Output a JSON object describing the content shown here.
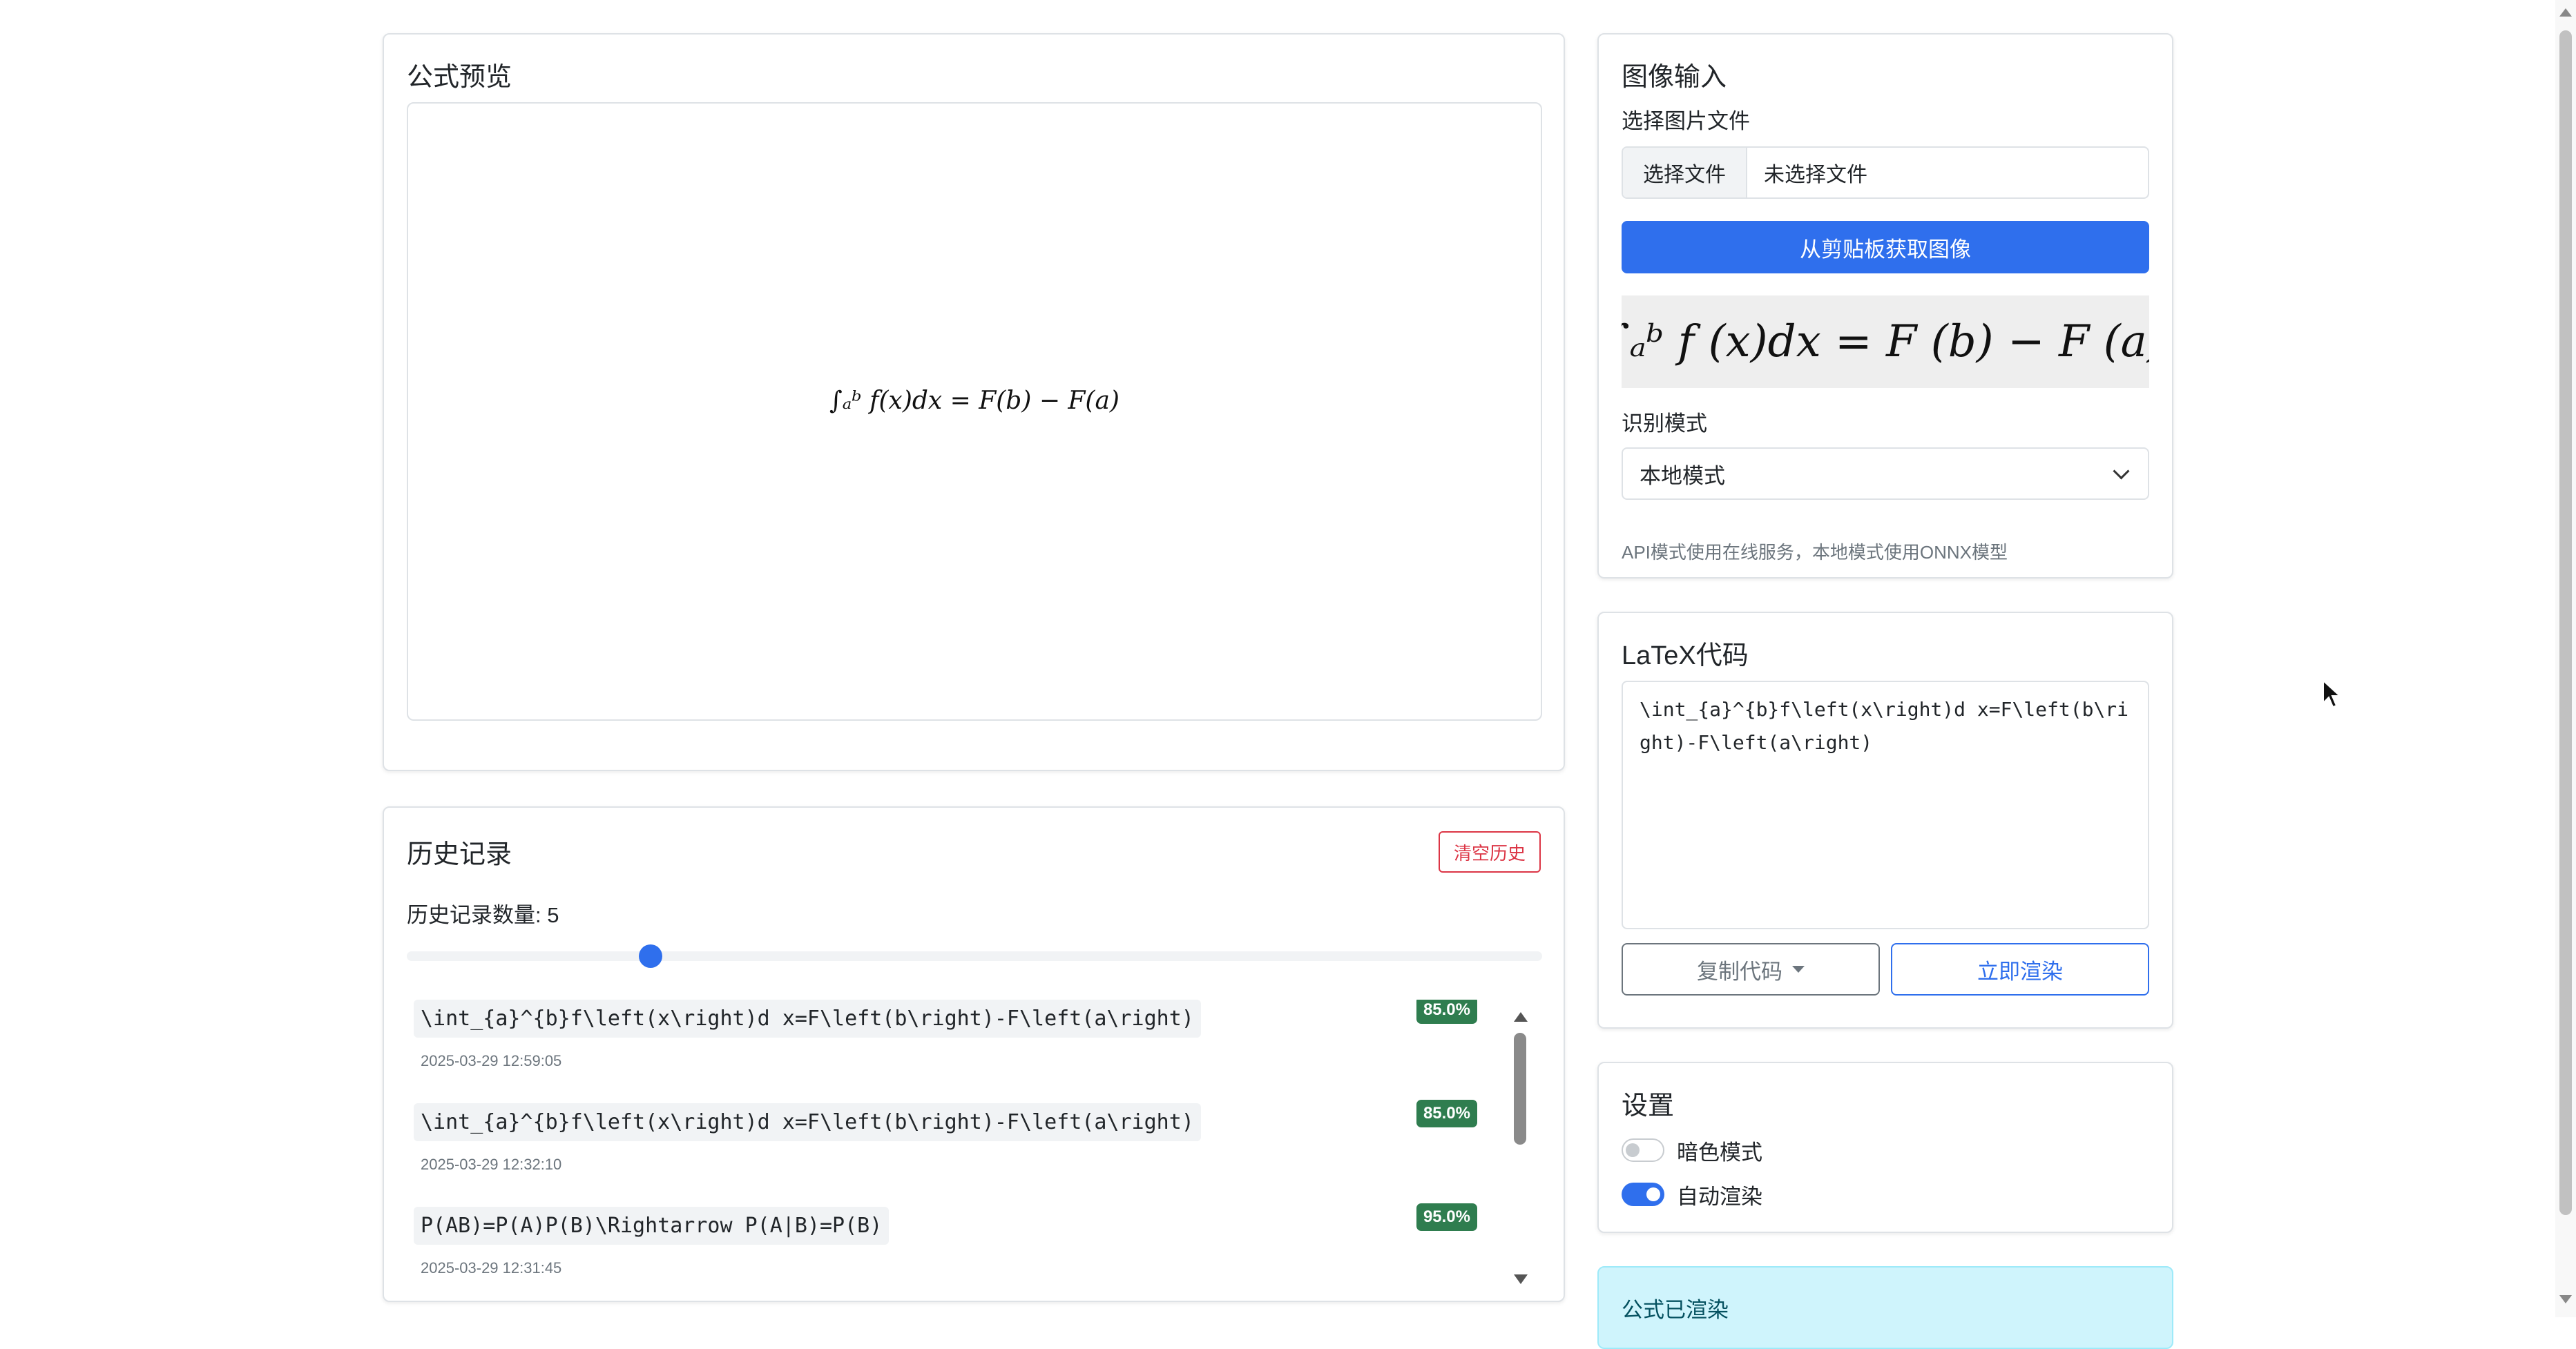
{
  "preview": {
    "title": "公式预览",
    "formula": "∫ₐᵇ f(x)dx = F(b) − F(a)"
  },
  "history": {
    "title": "历史记录",
    "clear_label": "清空历史",
    "count_label": "历史记录数量: 5",
    "slider_value": 5,
    "items": [
      {
        "code": "\\int_{a}^{b}f\\left(x\\right)d x=F\\left(b\\right)-F\\left(a\\right)",
        "time": "2025-03-29 12:59:05",
        "confidence": "85.0%"
      },
      {
        "code": "\\int_{a}^{b}f\\left(x\\right)d x=F\\left(b\\right)-F\\left(a\\right)",
        "time": "2025-03-29 12:32:10",
        "confidence": "85.0%"
      },
      {
        "code": "P(AB)=P(A)P(B)\\Rightarrow P(A|B)=P(B)",
        "time": "2025-03-29 12:31:45",
        "confidence": "95.0%"
      }
    ]
  },
  "image_input": {
    "title": "图像输入",
    "file_label": "选择图片文件",
    "file_button": "选择文件",
    "file_status": "未选择文件",
    "clipboard_button": "从剪贴板获取图像",
    "image_formula": "∫ₐᵇ f (x)dx = F (b) − F (a)",
    "mode_label": "识别模式",
    "mode_value": "本地模式",
    "mode_help": "API模式使用在线服务，本地模式使用ONNX模型"
  },
  "latex": {
    "title": "LaTeX代码",
    "code": "\\int_{a}^{b}f\\left(x\\right)d x=F\\left(b\\right)-F\\left(a\\right)",
    "copy_button": "复制代码",
    "render_button": "立即渲染"
  },
  "settings": {
    "title": "设置",
    "dark_mode_label": "暗色模式",
    "dark_mode": false,
    "auto_render_label": "自动渲染",
    "auto_render": true
  },
  "status": {
    "message": "公式已渲染"
  },
  "colors": {
    "primary": "#2f6fed",
    "danger": "#dc3545",
    "success_badge": "#2f7d4f",
    "info_bg": "#cff4fc"
  }
}
